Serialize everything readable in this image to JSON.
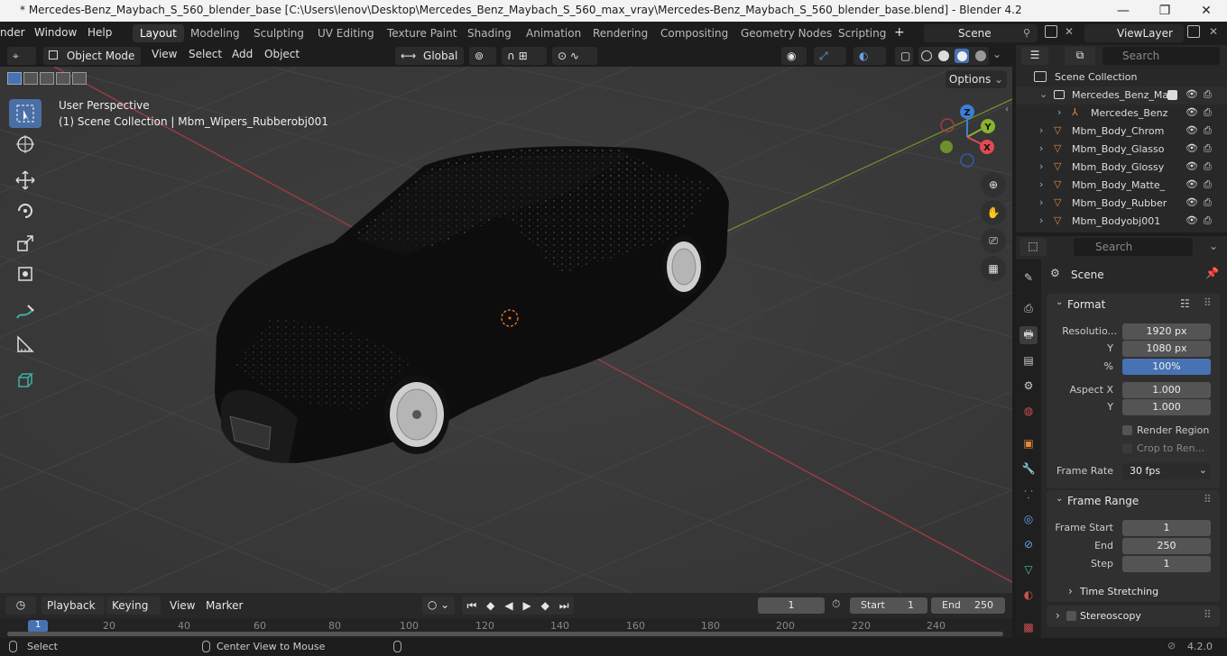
{
  "window": {
    "title": "* Mercedes-Benz_Maybach_S_560_blender_base [C:\\Users\\lenov\\Desktop\\Mercedes_Benz_Maybach_S_560_max_vray\\Mercedes-Benz_Maybach_S_560_blender_base.blend] - Blender 4.2",
    "minimize": "—",
    "maximize": "❐",
    "close": "✕"
  },
  "menu": {
    "items": [
      "nder",
      "Window",
      "Help"
    ],
    "workspaces": [
      "Layout",
      "Modeling",
      "Sculpting",
      "UV Editing",
      "Texture Paint",
      "Shading",
      "Animation",
      "Rendering",
      "Compositing",
      "Geometry Nodes",
      "Scripting"
    ],
    "active_workspace": "Layout",
    "add_tab": "+",
    "scene": "Scene",
    "view_layer": "ViewLayer"
  },
  "viewport_header": {
    "mode": "Object Mode",
    "menus": [
      "View",
      "Select",
      "Add",
      "Object"
    ],
    "orientation": "Global",
    "options": "Options"
  },
  "viewport": {
    "perspective": "User Perspective",
    "context": "(1) Scene Collection | Mbm_Wipers_Rubberobj001",
    "gizmo": {
      "x": "X",
      "y": "Y",
      "z": "Z"
    },
    "colors": {
      "x_axis": "#e24b54",
      "y_axis": "#88b42c",
      "z_axis": "#3d7fd8",
      "active_tool": "#4a6fa5"
    }
  },
  "outliner": {
    "search_placeholder": "Search",
    "root": "Scene Collection",
    "rows": [
      {
        "label": "Mercedes_Benz_Ma",
        "icon": "collection-icon"
      },
      {
        "label": "Mercedes_Benz",
        "icon": "armature-icon"
      },
      {
        "label": "Mbm_Body_Chrom",
        "icon": "mesh-icon"
      },
      {
        "label": "Mbm_Body_Glasso",
        "icon": "mesh-icon"
      },
      {
        "label": "Mbm_Body_Glossy",
        "icon": "mesh-icon"
      },
      {
        "label": "Mbm_Body_Matte_",
        "icon": "mesh-icon"
      },
      {
        "label": "Mbm_Body_Rubber",
        "icon": "mesh-icon"
      },
      {
        "label": "Mbm_Bodyobj001",
        "icon": "mesh-icon"
      }
    ]
  },
  "properties": {
    "search_placeholder": "Search",
    "context": "Scene",
    "format": {
      "title": "Format",
      "resolution_label": "Resolutio...",
      "resolution_x": "1920 px",
      "y_label": "Y",
      "resolution_y": "1080 px",
      "percent_label": "%",
      "percent": "100%",
      "aspect_x_label": "Aspect X",
      "aspect_x": "1.000",
      "aspect_y": "1.000",
      "render_region": "Render Region",
      "crop": "Crop to Ren...",
      "frame_rate_label": "Frame Rate",
      "frame_rate": "30 fps"
    },
    "frame_range": {
      "title": "Frame Range",
      "start_label": "Frame Start",
      "start": "1",
      "end_label": "End",
      "end": "250",
      "step_label": "Step",
      "step": "1"
    },
    "time_stretching": "Time Stretching",
    "stereoscopy": "Stereoscopy"
  },
  "timeline": {
    "menus": [
      "Playback",
      "Keying",
      "View",
      "Marker"
    ],
    "current_frame": "1",
    "start_label": "Start",
    "start": "1",
    "end_label": "End",
    "end": "250",
    "ruler": [
      "1",
      "20",
      "40",
      "60",
      "80",
      "100",
      "120",
      "140",
      "160",
      "180",
      "200",
      "220",
      "240"
    ]
  },
  "status": {
    "select": "Select",
    "center": "Center View to Mouse",
    "version": "4.2.0"
  }
}
